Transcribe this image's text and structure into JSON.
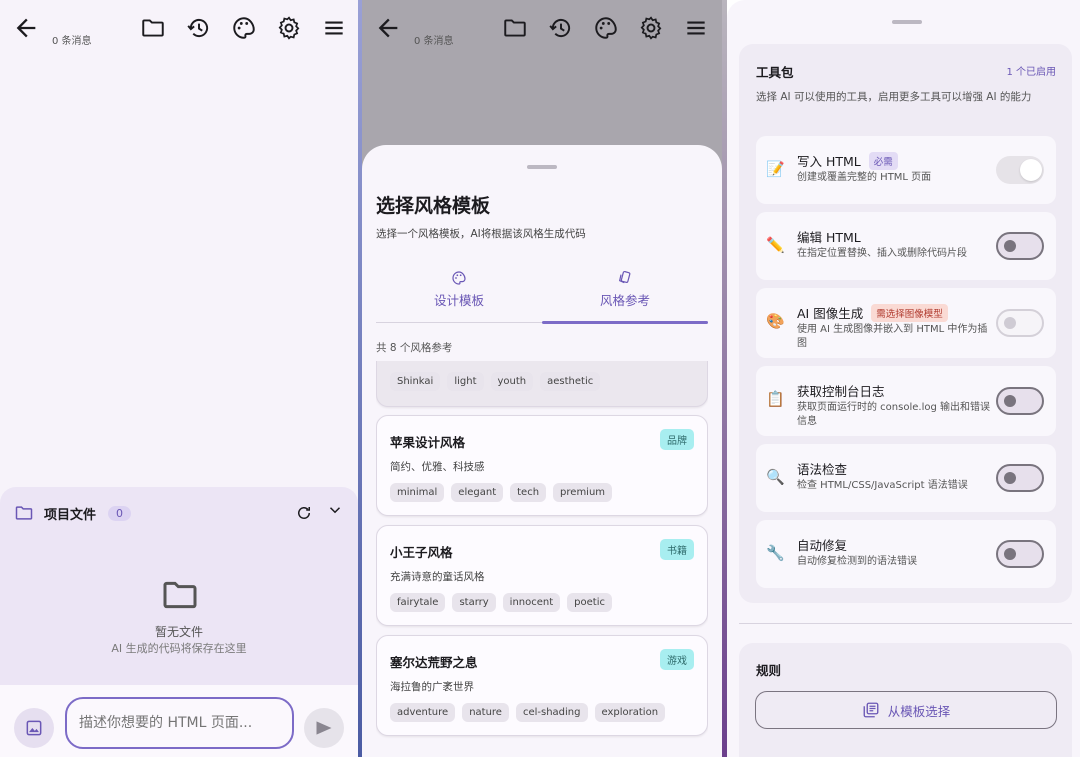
{
  "topbar": {
    "message_count": "0 条消息"
  },
  "files": {
    "title": "项目文件",
    "count": "0",
    "empty_title": "暂无文件",
    "empty_sub": "AI 生成的代码将保存在这里"
  },
  "composer": {
    "placeholder": "描述你想要的 HTML 页面..."
  },
  "style_sheet": {
    "title": "选择风格模板",
    "subtitle": "选择一个风格模板，AI将根据该风格生成代码",
    "tabs": [
      {
        "label": "设计模板",
        "icon": "palette-icon"
      },
      {
        "label": "风格参考",
        "icon": "cards-icon",
        "selected": true
      }
    ],
    "count_text": "共 8 个风格参考",
    "partial_tags": [
      "Shinkai",
      "light",
      "youth",
      "aesthetic"
    ],
    "styles": [
      {
        "name": "苹果设计风格",
        "desc": "简约、优雅、科技感",
        "category": "品牌",
        "tags": [
          "minimal",
          "elegant",
          "tech",
          "premium"
        ]
      },
      {
        "name": "小王子风格",
        "desc": "充满诗意的童话风格",
        "category": "书籍",
        "tags": [
          "fairytale",
          "starry",
          "innocent",
          "poetic"
        ]
      },
      {
        "name": "塞尔达荒野之息",
        "desc": "海拉鲁的广袤世界",
        "category": "游戏",
        "tags": [
          "adventure",
          "nature",
          "cel-shading",
          "exploration"
        ]
      }
    ]
  },
  "tools": {
    "title": "工具包",
    "enabled": "1 个已启用",
    "desc": "选择 AI 可以使用的工具，启用更多工具可以增强 AI 的能力",
    "items": [
      {
        "emoji": "📝",
        "name": "写入 HTML",
        "badge": "必需",
        "desc": "创建或覆盖完整的 HTML 页面",
        "state": "on-disabled"
      },
      {
        "emoji": "✏️",
        "name": "编辑 HTML",
        "badge": "",
        "desc": "在指定位置替换、插入或删除代码片段",
        "state": "off"
      },
      {
        "emoji": "🎨",
        "name": "AI 图像生成",
        "badge_warn": "需选择图像模型",
        "desc": "使用 AI 生成图像并嵌入到 HTML 中作为插图",
        "state": "disabled"
      },
      {
        "emoji": "📋",
        "name": "获取控制台日志",
        "badge": "",
        "desc": "获取页面运行时的 console.log 输出和错误信息",
        "state": "off"
      },
      {
        "emoji": "🔍",
        "name": "语法检查",
        "badge": "",
        "desc": "检查 HTML/CSS/JavaScript 语法错误",
        "state": "off"
      },
      {
        "emoji": "🔧",
        "name": "自动修复",
        "badge": "",
        "desc": "自动修复检测到的语法错误",
        "state": "off"
      }
    ]
  },
  "rules": {
    "title": "规则",
    "template_button": "从模板选择"
  }
}
